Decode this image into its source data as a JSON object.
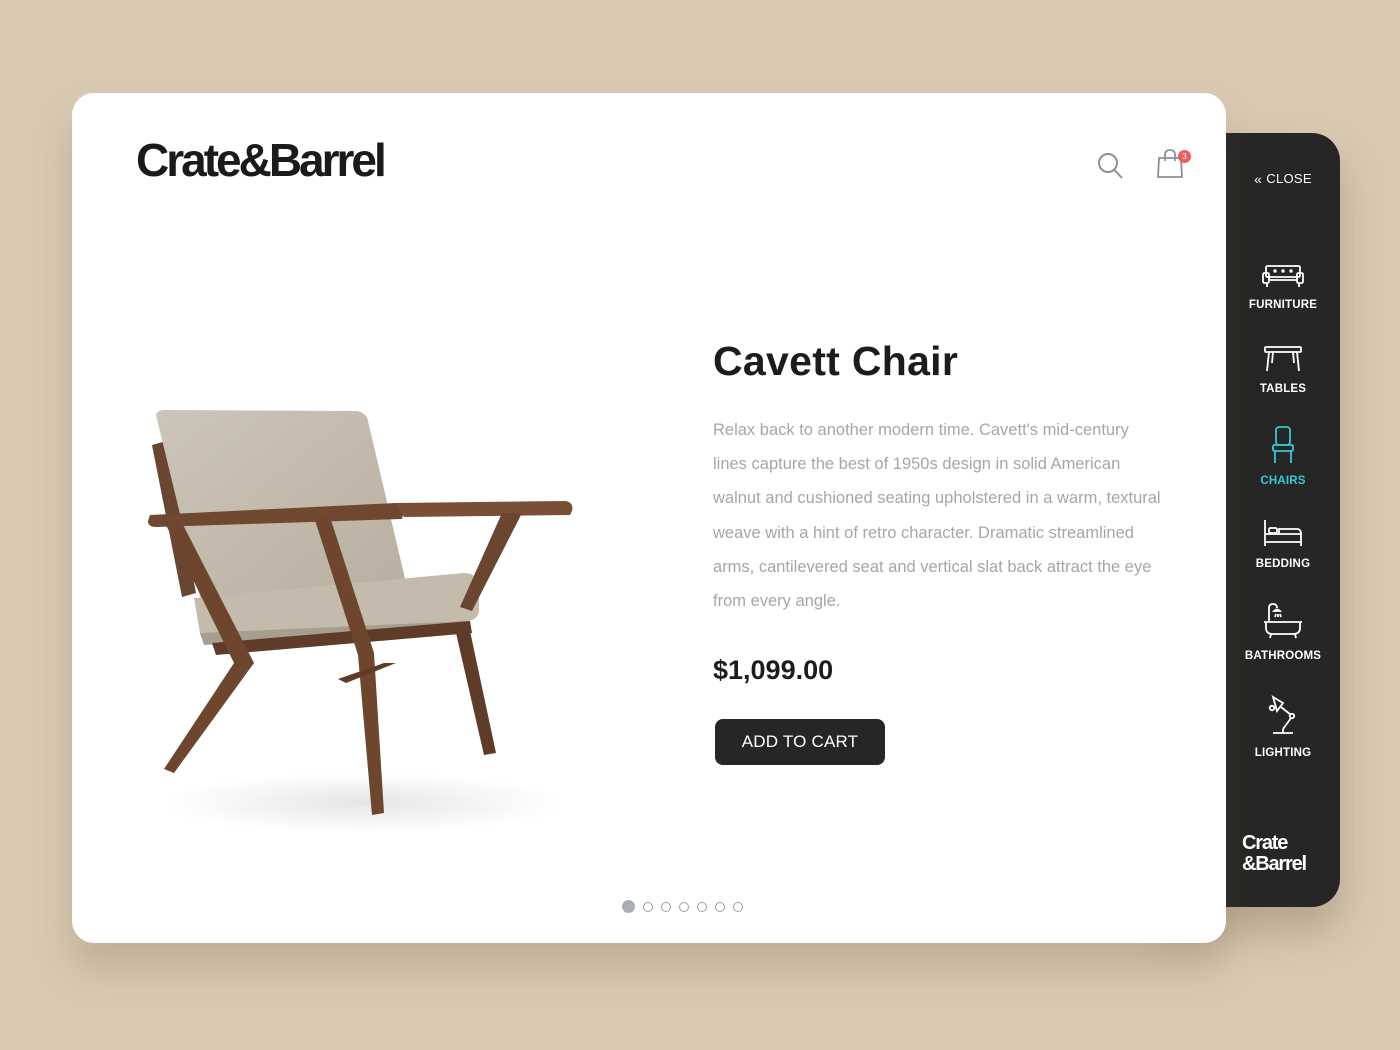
{
  "brand": {
    "name": "Crate&Barrel"
  },
  "header": {
    "cart_count": "3"
  },
  "product": {
    "name": "Cavett Chair",
    "description": "Relax back to another modern time. Cavett's mid-century lines capture the best of 1950s design in solid American walnut and cushioned seating upholstered in a warm, textural weave with a hint of retro character. Dramatic streamlined arms, cantilevered seat and vertical slat back attract the eye from every angle.",
    "price": "$1,099.00",
    "cta_label": "ADD TO CART"
  },
  "carousel": {
    "total": 7,
    "active_index": 0
  },
  "side_menu": {
    "close_label": "CLOSE",
    "logo_line1": "Crate",
    "logo_line2": "&Barrel",
    "active_color": "#35c8d8",
    "items": [
      {
        "label": "FURNITURE",
        "icon": "sofa-icon",
        "active": false
      },
      {
        "label": "TABLES",
        "icon": "table-icon",
        "active": false
      },
      {
        "label": "CHAIRS",
        "icon": "chair-icon",
        "active": true
      },
      {
        "label": "BEDDING",
        "icon": "bed-icon",
        "active": false
      },
      {
        "label": "BATHROOMS",
        "icon": "bathtub-icon",
        "active": false
      },
      {
        "label": "LIGHTING",
        "icon": "desk-lamp-icon",
        "active": false
      }
    ]
  }
}
